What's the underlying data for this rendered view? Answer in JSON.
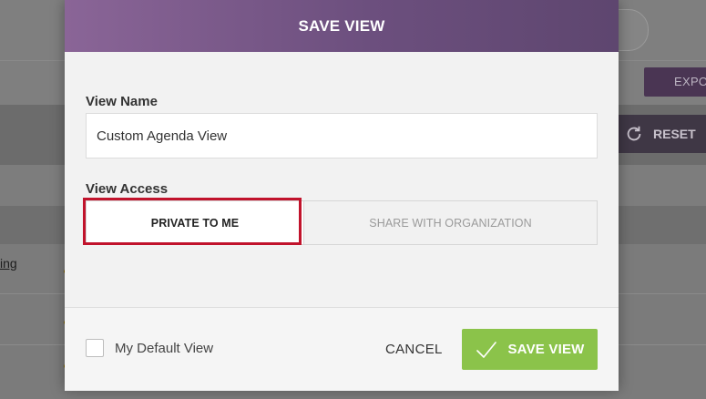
{
  "background": {
    "export_label": "EXPO",
    "reset_label": "RESET",
    "link_text": "ing"
  },
  "modal": {
    "title": "SAVE VIEW",
    "view_name_label": "View Name",
    "view_name_value": "Custom Agenda View",
    "view_access_label": "View Access",
    "access_options": [
      "PRIVATE TO ME",
      "SHARE WITH ORGANIZATION"
    ],
    "selected_access": "PRIVATE TO ME",
    "default_view_label": "My Default View",
    "default_view_checked": false,
    "cancel_label": "CANCEL",
    "save_label": "SAVE VIEW"
  },
  "colors": {
    "header_start": "#8a6597",
    "header_end": "#5e466f",
    "save_button": "#8bc34a",
    "highlight": "#c1132c"
  },
  "icons": {
    "reset": "refresh-icon",
    "save": "checkmark-icon"
  }
}
